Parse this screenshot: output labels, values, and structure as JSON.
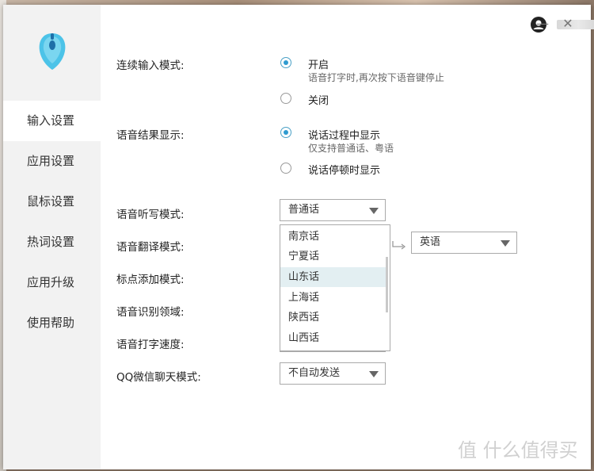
{
  "sidebar": {
    "items": [
      {
        "label": "输入设置"
      },
      {
        "label": "应用设置"
      },
      {
        "label": "鼠标设置"
      },
      {
        "label": "热词设置"
      },
      {
        "label": "应用升级"
      },
      {
        "label": "使用帮助"
      }
    ],
    "active_index": 0
  },
  "window": {
    "minimize": "—",
    "close": "✕"
  },
  "settings": {
    "continuous_input": {
      "label": "连续输入模式:",
      "options": [
        {
          "text": "开启",
          "sub": "语音打字时,再次按下语音键停止",
          "checked": true
        },
        {
          "text": "关闭",
          "checked": false
        }
      ]
    },
    "result_display": {
      "label": "语音结果显示:",
      "options": [
        {
          "text": "说话过程中显示",
          "sub": "仅支持普通话、粤语",
          "checked": true
        },
        {
          "text": "说话停顿时显示",
          "checked": false
        }
      ]
    },
    "dictation_mode": {
      "label": "语音听写模式:",
      "value": "普通话"
    },
    "translation_mode": {
      "label": "语音翻译模式:",
      "target": "英语"
    },
    "punctuation_mode": {
      "label": "标点添加模式:"
    },
    "recognition_domain": {
      "label": "语音识别领域:"
    },
    "typing_speed": {
      "label": "语音打字速度:"
    },
    "qq_wechat_mode": {
      "label": "QQ微信聊天模式:",
      "value": "不自动发送"
    }
  },
  "dropdown": {
    "items": [
      "南京话",
      "宁夏话",
      "山东话",
      "上海话",
      "陕西话",
      "山西话"
    ],
    "highlighted_index": 2
  },
  "watermark": "值 什么值得买",
  "colors": {
    "accent": "#2f9bd0",
    "sidebar_bg": "#f2f2f2",
    "highlight": "#e3eff2"
  }
}
